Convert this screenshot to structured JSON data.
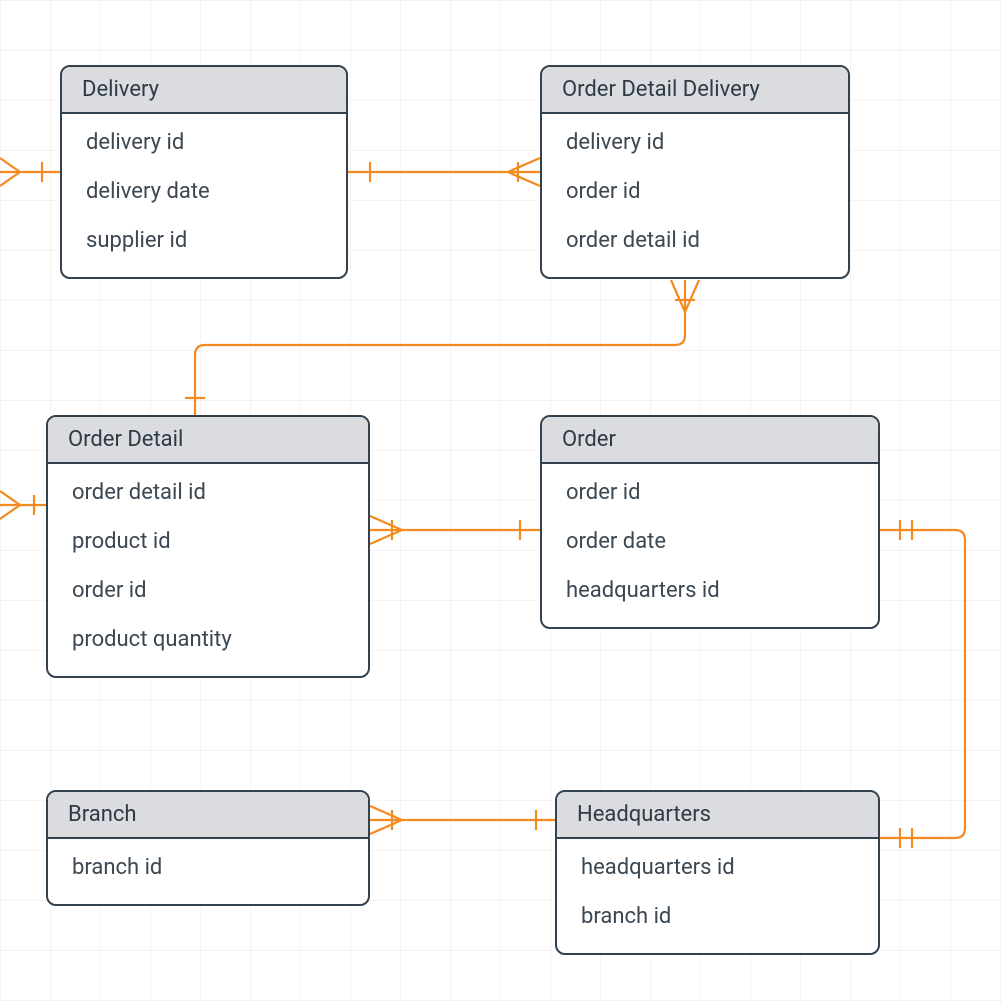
{
  "entities": {
    "delivery": {
      "title": "Delivery",
      "attrs": [
        "delivery id",
        "delivery date",
        "supplier id"
      ]
    },
    "orderDetailDelivery": {
      "title": "Order Detail Delivery",
      "attrs": [
        "delivery id",
        "order id",
        "order detail id"
      ]
    },
    "orderDetail": {
      "title": "Order Detail",
      "attrs": [
        "order detail id",
        "product id",
        "order id",
        "product quantity"
      ]
    },
    "order": {
      "title": "Order",
      "attrs": [
        "order id",
        "order date",
        "headquarters id"
      ]
    },
    "branch": {
      "title": "Branch",
      "attrs": [
        "branch id"
      ]
    },
    "headquarters": {
      "title": "Headquarters",
      "attrs": [
        "headquarters id",
        "branch id"
      ]
    }
  },
  "colors": {
    "connector": "#f28a1f",
    "border": "#34424f",
    "header": "#dadcdf"
  }
}
